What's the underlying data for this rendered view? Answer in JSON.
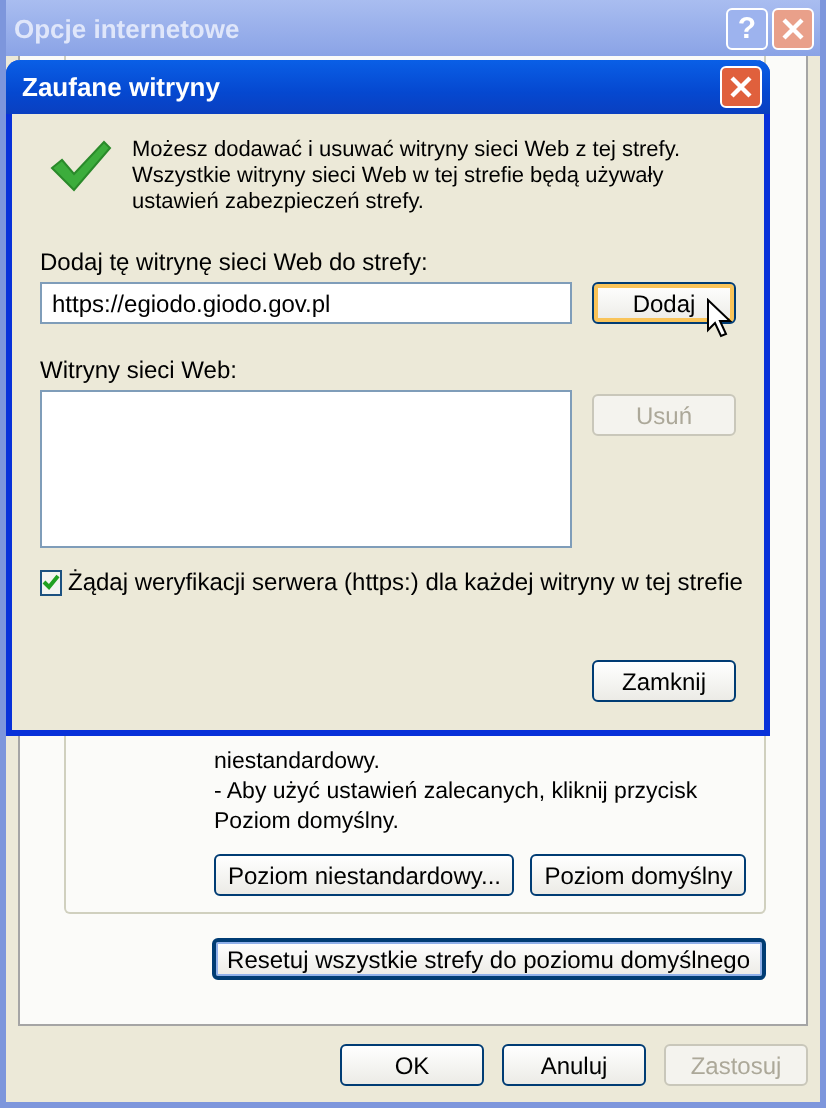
{
  "window": {
    "title": "Opcje internetowe",
    "help_button": "?"
  },
  "panel": {
    "text_lines": [
      "niestandardowy.",
      "- Aby użyć ustawień zalecanych, kliknij przycisk Poziom domyślny."
    ],
    "buttons": [
      {
        "label": "Poziom niestandardowy...",
        "focused": false
      },
      {
        "label": "Poziom domyślny",
        "focused": false
      }
    ],
    "reset_button": {
      "label": "Resetuj wszystkie strefy do poziomu domyślnego",
      "focused": true
    }
  },
  "footer_buttons": [
    {
      "label": "OK",
      "disabled": false
    },
    {
      "label": "Anuluj",
      "disabled": false
    },
    {
      "label": "Zastosuj",
      "disabled": true
    }
  ],
  "dialog": {
    "title": "Zaufane witryny",
    "message": "Możesz dodawać i usuwać witryny sieci Web z tej strefy. Wszystkie witryny sieci Web w tej strefie będą używały ustawień zabezpieczeń strefy.",
    "add_label": "Dodaj tę witrynę sieci Web do strefy:",
    "add_value": "https://egiodo.giodo.gov.pl",
    "add_button": {
      "label": "Dodaj",
      "hovered": true,
      "disabled": false
    },
    "list_label": "Witryny sieci Web:",
    "remove_button": {
      "label": "Usuń",
      "hovered": false,
      "disabled": true
    },
    "checkbox": {
      "label": "Żądaj weryfikacji serwera (https:) dla każdej witryny w tej strefie",
      "checked": true
    },
    "close_button": {
      "label": "Zamknij",
      "hovered": false,
      "disabled": false
    }
  }
}
